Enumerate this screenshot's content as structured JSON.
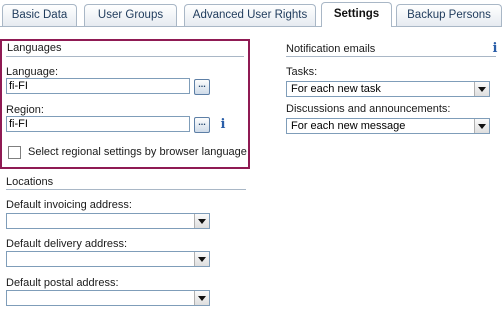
{
  "tabs": [
    {
      "label": "Basic Data",
      "active": false
    },
    {
      "label": "User Groups",
      "active": false
    },
    {
      "label": "Advanced User Rights",
      "active": false
    },
    {
      "label": "Settings",
      "active": true
    },
    {
      "label": "Backup Persons",
      "active": false
    }
  ],
  "languages": {
    "title": "Languages",
    "language_label": "Language:",
    "language_value": "fi-FI",
    "region_label": "Region:",
    "region_value": "fi-FI",
    "browser_checkbox_label": "Select regional settings by browser language",
    "browser_checkbox_checked": false,
    "dots_label": "..."
  },
  "notifications": {
    "title": "Notification emails",
    "tasks_label": "Tasks:",
    "tasks_value": "For each new task",
    "discussions_label": "Discussions and announcements:",
    "discussions_value": "For each new message"
  },
  "locations": {
    "title": "Locations",
    "invoicing_label": "Default invoicing address:",
    "invoicing_value": "",
    "delivery_label": "Default delivery address:",
    "delivery_value": "",
    "postal_label": "Default postal address:",
    "postal_value": ""
  },
  "icons": {
    "info": "i"
  },
  "colors": {
    "highlight_border": "#8f1a53",
    "info_icon": "#2a5ea8"
  }
}
